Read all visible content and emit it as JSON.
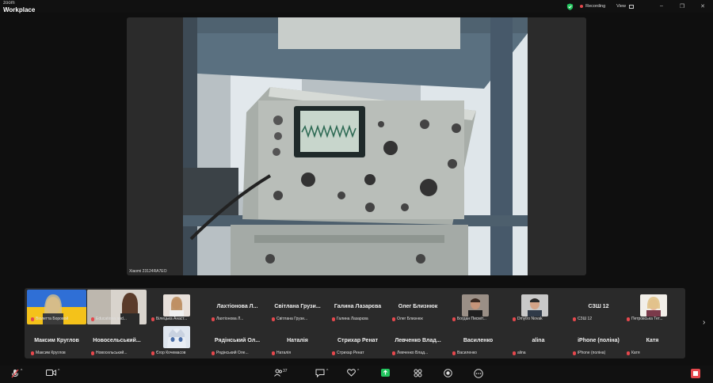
{
  "app": {
    "brand_top": "zoom",
    "brand_bottom": "Workplace"
  },
  "topbar": {
    "recording_label": "Recording",
    "view_label": "View",
    "minimize": "–",
    "maximize": "❐",
    "close": "✕"
  },
  "share": {
    "device_name": "Xiaomi 23124RA7EO"
  },
  "participants": [
    {
      "name": "Віолетта Боровой",
      "label": "Віолетта Боровой",
      "has_video": true
    },
    {
      "name": "Educationa and...",
      "label": "Educationa and...",
      "has_video": true
    },
    {
      "name": "Білецька Анаст...",
      "label": "Білецька Анаст...",
      "has_video": true
    },
    {
      "name": "Лахтіонова Л...",
      "label": "Лахтіонова Л...",
      "has_video": false
    },
    {
      "name": "Світлана Грузи...",
      "label": "Світлана Грузи...",
      "has_video": false
    },
    {
      "name": "Галина Лазарєва",
      "label": "Галина Лазарєва",
      "has_video": false
    },
    {
      "name": "Олег Близнюк",
      "label": "Олег Близнюк",
      "has_video": false
    },
    {
      "name": "Богдан Писміт...",
      "label": "Богдан Писміт...",
      "has_video": true
    },
    {
      "name": "Dmytro Novak",
      "label": "Dmytro Novak",
      "has_video": true
    },
    {
      "name": "СЗШ 12",
      "label": "СЗШ 12",
      "has_video": false
    },
    {
      "name": "Петровська Тет...",
      "label": "Петровська Тет...",
      "has_video": true
    },
    {
      "name": "Максим Круглов",
      "label": "Максим Круглов",
      "has_video": false
    },
    {
      "name": "Новосельський...",
      "label": "Новосельський...",
      "has_video": false
    },
    {
      "name": "Єгор Кочемасов",
      "label": "Єгор Кочемасов",
      "has_video": true
    },
    {
      "name": "Рядінський Ол...",
      "label": "Рядінський Оле...",
      "has_video": false
    },
    {
      "name": "Наталія",
      "label": "Наталія",
      "has_video": false
    },
    {
      "name": "Стрихар Ренат",
      "label": "Стрихар Ренат",
      "has_video": false
    },
    {
      "name": "Левченко Влад...",
      "label": "Левченко Влад...",
      "has_video": false
    },
    {
      "name": "Василенко",
      "label": "Василенко",
      "has_video": false
    },
    {
      "name": "alina",
      "label": "alina",
      "has_video": false
    },
    {
      "name": "iPhone (поліна)",
      "label": "iPhone (поліна)",
      "has_video": false
    },
    {
      "name": "Катя",
      "label": "Катя",
      "has_video": false
    }
  ],
  "toolbar": {
    "participants_count": "37",
    "caret": "^",
    "next_page": "›"
  },
  "colors": {
    "accent_red": "#e5484d",
    "share_green": "#22c55e",
    "shield_green": "#22c55e"
  }
}
